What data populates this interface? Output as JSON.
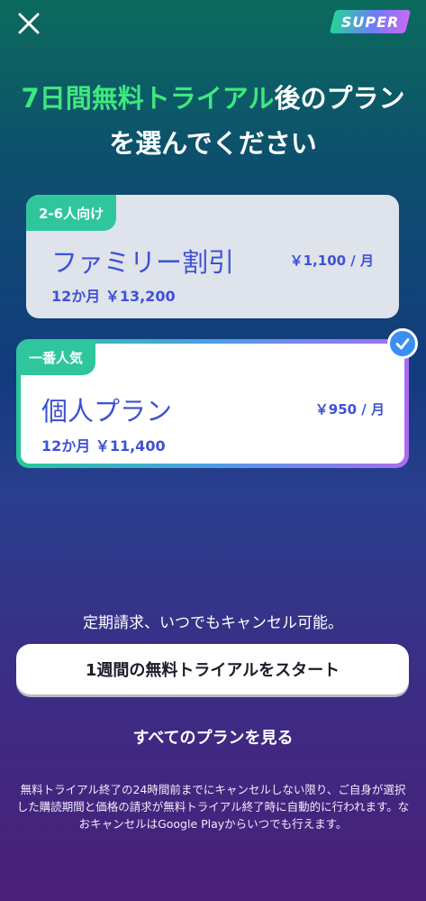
{
  "header": {
    "close_icon": "close-icon",
    "badge_label": "SUPER"
  },
  "headline": {
    "highlight": "7日間無料トライアル",
    "rest_line1": "後のプラン",
    "line2": "を選んでください"
  },
  "plans": [
    {
      "tag": "2-6人向け",
      "name": "ファミリー割引",
      "price": "￥1,100 / 月",
      "total": "12か月 ￥13,200",
      "selected": false
    },
    {
      "tag": "一番人気",
      "name": "個人プラン",
      "price": "￥950 / 月",
      "total": "12か月 ￥11,400",
      "selected": true
    }
  ],
  "colors": {
    "accent_green": "#3ee87e",
    "plan_text": "#3e52d4",
    "tag_bg": "#2fc69d",
    "check_bg": "#3a8ff1"
  },
  "note": "定期請求、いつでもキャンセル可能。",
  "cta_label": "1週間の無料トライアルをスタート",
  "all_plans_label": "すべてのプランを見る",
  "fine_print": "無料トライアル終了の24時間前までにキャンセルしない限り、ご自身が選択した購読期間と価格の請求が無料トライアル終了時に自動的に行われます。なおキャンセルはGoogle Playからいつでも行えます。"
}
